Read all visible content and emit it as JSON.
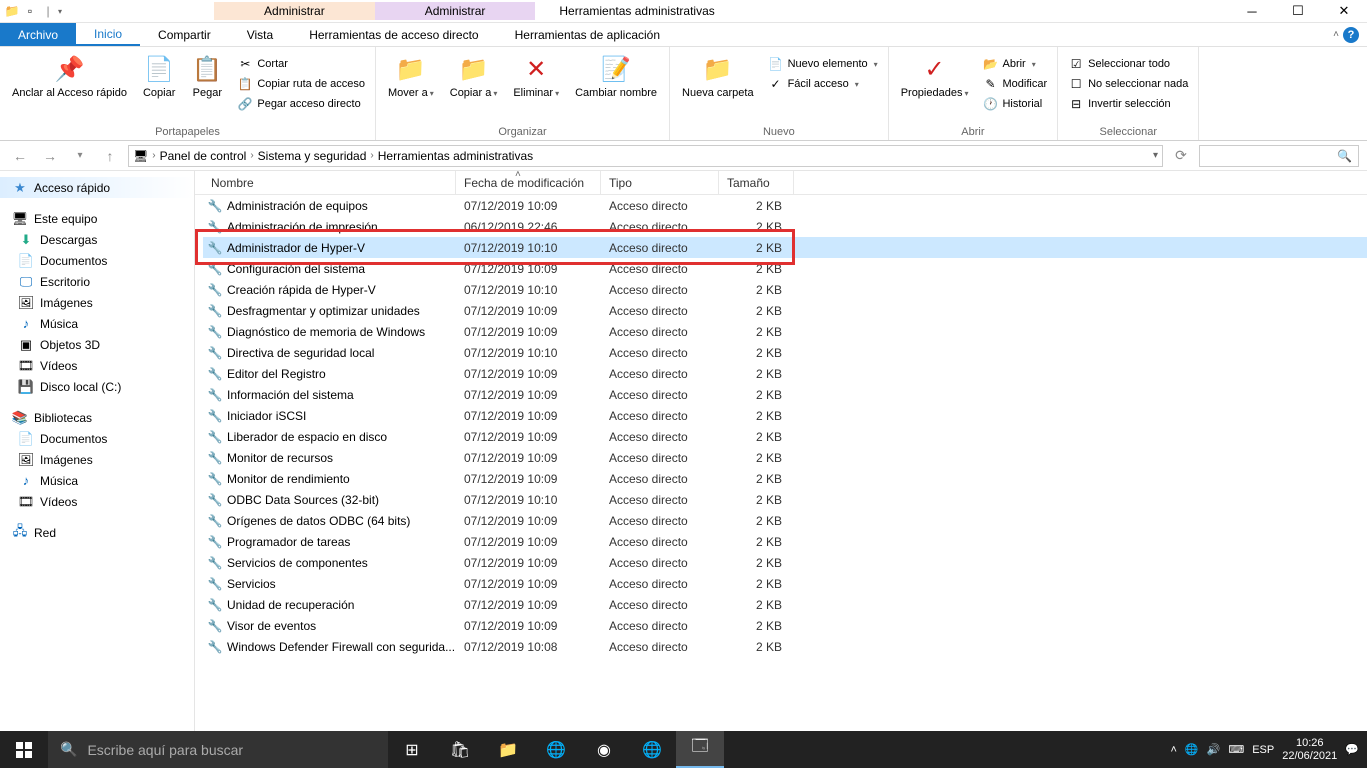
{
  "window": {
    "title": "Herramientas administrativas",
    "manage_tab1": "Administrar",
    "manage_tab2": "Administrar"
  },
  "tabs": {
    "file": "Archivo",
    "home": "Inicio",
    "share": "Compartir",
    "view": "Vista",
    "shortcut_tools": "Herramientas de acceso directo",
    "app_tools": "Herramientas de aplicación"
  },
  "ribbon": {
    "pin": "Anclar al Acceso rápido",
    "copy": "Copiar",
    "paste": "Pegar",
    "cut": "Cortar",
    "copy_path": "Copiar ruta de acceso",
    "paste_shortcut": "Pegar acceso directo",
    "clipboard": "Portapapeles",
    "move_to": "Mover a",
    "copy_to": "Copiar a",
    "delete": "Eliminar",
    "rename": "Cambiar nombre",
    "organize": "Organizar",
    "new_folder": "Nueva carpeta",
    "new_item": "Nuevo elemento",
    "easy_access": "Fácil acceso",
    "new": "Nuevo",
    "properties": "Propiedades",
    "open_btn": "Abrir",
    "edit": "Modificar",
    "history": "Historial",
    "open": "Abrir",
    "select_all": "Seleccionar todo",
    "select_none": "No seleccionar nada",
    "invert_sel": "Invertir selección",
    "select": "Seleccionar"
  },
  "breadcrumb": {
    "p1": "Panel de control",
    "p2": "Sistema y seguridad",
    "p3": "Herramientas administrativas"
  },
  "nav": {
    "quick_access": "Acceso rápido",
    "this_pc": "Este equipo",
    "downloads": "Descargas",
    "documents": "Documentos",
    "desktop": "Escritorio",
    "pictures": "Imágenes",
    "music": "Música",
    "objects3d": "Objetos 3D",
    "videos": "Vídeos",
    "local_disk": "Disco local (C:)",
    "libraries": "Bibliotecas",
    "lib_documents": "Documentos",
    "lib_pictures": "Imágenes",
    "lib_music": "Música",
    "lib_videos": "Vídeos",
    "network": "Red"
  },
  "columns": {
    "name": "Nombre",
    "date": "Fecha de modificación",
    "type": "Tipo",
    "size": "Tamaño"
  },
  "files": [
    {
      "name": "Administración de equipos",
      "date": "07/12/2019 10:09",
      "type": "Acceso directo",
      "size": "2 KB"
    },
    {
      "name": "Administración de impresión",
      "date": "06/12/2019 22:46",
      "type": "Acceso directo",
      "size": "2 KB"
    },
    {
      "name": "Administrador de Hyper-V",
      "date": "07/12/2019 10:10",
      "type": "Acceso directo",
      "size": "2 KB",
      "selected": true,
      "highlighted": true
    },
    {
      "name": "Configuración del sistema",
      "date": "07/12/2019 10:09",
      "type": "Acceso directo",
      "size": "2 KB"
    },
    {
      "name": "Creación rápida de Hyper-V",
      "date": "07/12/2019 10:10",
      "type": "Acceso directo",
      "size": "2 KB"
    },
    {
      "name": "Desfragmentar y optimizar unidades",
      "date": "07/12/2019 10:09",
      "type": "Acceso directo",
      "size": "2 KB"
    },
    {
      "name": "Diagnóstico de memoria de Windows",
      "date": "07/12/2019 10:09",
      "type": "Acceso directo",
      "size": "2 KB"
    },
    {
      "name": "Directiva de seguridad local",
      "date": "07/12/2019 10:10",
      "type": "Acceso directo",
      "size": "2 KB"
    },
    {
      "name": "Editor del Registro",
      "date": "07/12/2019 10:09",
      "type": "Acceso directo",
      "size": "2 KB"
    },
    {
      "name": "Información del sistema",
      "date": "07/12/2019 10:09",
      "type": "Acceso directo",
      "size": "2 KB"
    },
    {
      "name": "Iniciador iSCSI",
      "date": "07/12/2019 10:09",
      "type": "Acceso directo",
      "size": "2 KB"
    },
    {
      "name": "Liberador de espacio en disco",
      "date": "07/12/2019 10:09",
      "type": "Acceso directo",
      "size": "2 KB"
    },
    {
      "name": "Monitor de recursos",
      "date": "07/12/2019 10:09",
      "type": "Acceso directo",
      "size": "2 KB"
    },
    {
      "name": "Monitor de rendimiento",
      "date": "07/12/2019 10:09",
      "type": "Acceso directo",
      "size": "2 KB"
    },
    {
      "name": "ODBC Data Sources (32-bit)",
      "date": "07/12/2019 10:10",
      "type": "Acceso directo",
      "size": "2 KB"
    },
    {
      "name": "Orígenes de datos ODBC (64 bits)",
      "date": "07/12/2019 10:09",
      "type": "Acceso directo",
      "size": "2 KB"
    },
    {
      "name": "Programador de tareas",
      "date": "07/12/2019 10:09",
      "type": "Acceso directo",
      "size": "2 KB"
    },
    {
      "name": "Servicios de componentes",
      "date": "07/12/2019 10:09",
      "type": "Acceso directo",
      "size": "2 KB"
    },
    {
      "name": "Servicios",
      "date": "07/12/2019 10:09",
      "type": "Acceso directo",
      "size": "2 KB"
    },
    {
      "name": "Unidad de recuperación",
      "date": "07/12/2019 10:09",
      "type": "Acceso directo",
      "size": "2 KB"
    },
    {
      "name": "Visor de eventos",
      "date": "07/12/2019 10:09",
      "type": "Acceso directo",
      "size": "2 KB"
    },
    {
      "name": "Windows Defender Firewall con segurida...",
      "date": "07/12/2019 10:08",
      "type": "Acceso directo",
      "size": "2 KB"
    }
  ],
  "taskbar": {
    "search_placeholder": "Escribe aquí para buscar",
    "lang": "ESP",
    "time": "10:26",
    "date": "22/06/2021"
  }
}
